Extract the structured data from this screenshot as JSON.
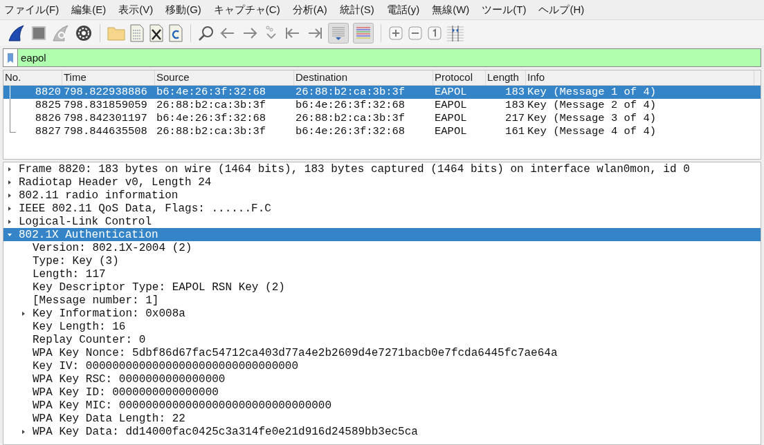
{
  "menu": [
    "ファイル(F)",
    "編集(E)",
    "表示(V)",
    "移動(G)",
    "キャプチャ(C)",
    "分析(A)",
    "統計(S)",
    "電話(y)",
    "無線(W)",
    "ツール(T)",
    "ヘルプ(H)"
  ],
  "filter": {
    "value": "eapol"
  },
  "packet_list": {
    "columns": [
      "No.",
      "Time",
      "Source",
      "Destination",
      "Protocol",
      "Length",
      "Info"
    ],
    "rows": [
      {
        "cells": [
          "8820",
          "798.822938886",
          "b6:4e:26:3f:32:68",
          "26:88:b2:ca:3b:3f",
          "EAPOL",
          "183",
          "Key (Message 1 of 4)"
        ],
        "selected": true
      },
      {
        "cells": [
          "8825",
          "798.831859059",
          "26:88:b2:ca:3b:3f",
          "b6:4e:26:3f:32:68",
          "EAPOL",
          "183",
          "Key (Message 2 of 4)"
        ],
        "selected": false
      },
      {
        "cells": [
          "8826",
          "798.842301197",
          "b6:4e:26:3f:32:68",
          "26:88:b2:ca:3b:3f",
          "EAPOL",
          "217",
          "Key (Message 3 of 4)"
        ],
        "selected": false
      },
      {
        "cells": [
          "8827",
          "798.844635508",
          "26:88:b2:ca:3b:3f",
          "b6:4e:26:3f:32:68",
          "EAPOL",
          "161",
          "Key (Message 4 of 4)"
        ],
        "selected": false
      }
    ]
  },
  "details": [
    {
      "text": "Frame 8820: 183 bytes on wire (1464 bits), 183 bytes captured (1464 bits) on interface wlan0mon, id 0",
      "expanded": false,
      "selected": false
    },
    {
      "text": "Radiotap Header v0, Length 24",
      "expanded": false,
      "selected": false
    },
    {
      "text": "802.11 radio information",
      "expanded": false,
      "selected": false
    },
    {
      "text": "IEEE 802.11 QoS Data, Flags: ......F.C",
      "expanded": false,
      "selected": false
    },
    {
      "text": "Logical-Link Control",
      "expanded": false,
      "selected": false
    },
    {
      "text": "802.1X Authentication",
      "expanded": true,
      "selected": true,
      "children": [
        {
          "text": "Version: 802.1X-2004 (2)",
          "selected": false
        },
        {
          "text": "Type: Key (3)",
          "selected": false
        },
        {
          "text": "Length: 117",
          "selected": false
        },
        {
          "text": "Key Descriptor Type: EAPOL RSN Key (2)",
          "selected": false
        },
        {
          "text": "[Message number: 1]",
          "selected": false
        },
        {
          "text": "Key Information: 0x008a",
          "expanded": false,
          "selected": false
        },
        {
          "text": "Key Length: 16",
          "selected": false
        },
        {
          "text": "Replay Counter: 0",
          "selected": false
        },
        {
          "text": "WPA Key Nonce: 5dbf86d67fac54712ca403d77a4e2b2609d4e7271bacb0e7fcda6445fc7ae64a",
          "selected": false
        },
        {
          "text": "Key IV: 00000000000000000000000000000000",
          "selected": false
        },
        {
          "text": "WPA Key RSC: 0000000000000000",
          "selected": false
        },
        {
          "text": "WPA Key ID: 0000000000000000",
          "selected": false
        },
        {
          "text": "WPA Key MIC: 00000000000000000000000000000000",
          "selected": false
        },
        {
          "text": "WPA Key Data Length: 22",
          "selected": false
        },
        {
          "text": "WPA Key Data: dd14000fac0425c3a314fe0e21d916d24589bb3ec5ca",
          "expanded": false,
          "selected": false
        }
      ]
    }
  ]
}
